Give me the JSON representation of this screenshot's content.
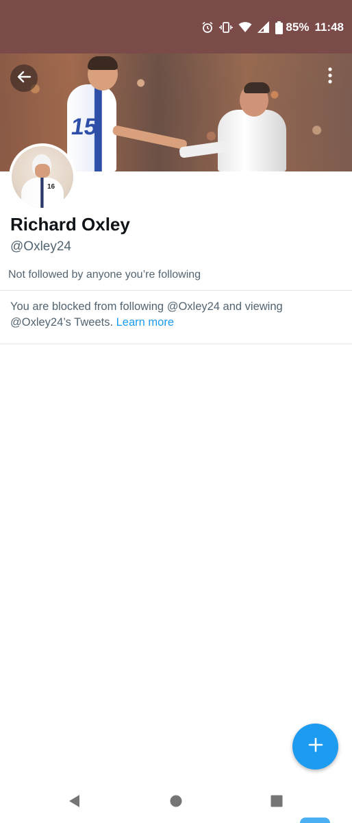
{
  "status_bar": {
    "battery_percent": "85%",
    "time": "11:48",
    "icons": [
      "alarm-icon",
      "vibrate-icon",
      "wifi-icon",
      "signal-icon",
      "battery-icon"
    ],
    "background_color": "#7a4b48"
  },
  "banner": {
    "shirt_number": "15",
    "back_icon": "arrow-left-icon",
    "more_icon": "more-vertical-icon"
  },
  "avatar": {
    "shirt_number": "16"
  },
  "profile": {
    "display_name": "Richard Oxley",
    "handle": "@Oxley24",
    "followers_note": "Not followed by anyone you’re following"
  },
  "blocked": {
    "message": "You are blocked from following @Oxley24 and viewing @Oxley24’s Tweets. ",
    "link_label": "Learn more",
    "link_color": "#1d9bf0"
  },
  "fab": {
    "icon": "plus-icon",
    "color": "#1d9bf0"
  },
  "nav_bar": {
    "icons": [
      "back-triangle-icon",
      "home-circle-icon",
      "recents-square-icon"
    ]
  }
}
